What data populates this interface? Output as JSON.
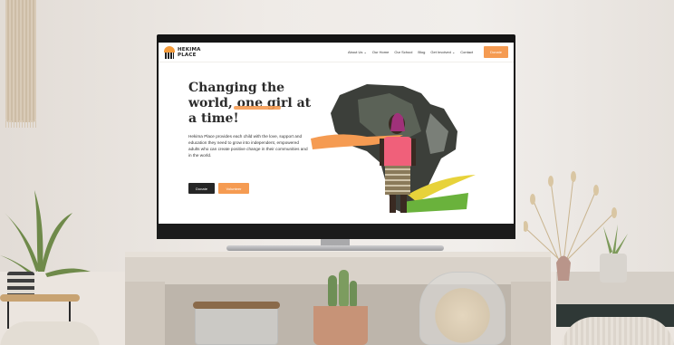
{
  "site": {
    "logo_line1": "HEKIMA",
    "logo_line2": "PLACE"
  },
  "nav": {
    "items": [
      {
        "label": "About Us ⌄"
      },
      {
        "label": "Our Home"
      },
      {
        "label": "Our School"
      },
      {
        "label": "Blog"
      },
      {
        "label": "Get Involved ⌄"
      },
      {
        "label": "Contact"
      }
    ],
    "donate_label": "Donate"
  },
  "hero": {
    "title_part1": "Changing the world, ",
    "title_highlight": "one girl",
    "title_part2": " at a time!",
    "description": "Hekima Place provides each child with the love, support and education they need to grow into independent, empowered adults who can create positive change in their communities and in the world.",
    "donate_button": "Donate",
    "volunteer_button": "Volunteer"
  },
  "colors": {
    "accent": "#f59b52",
    "dark": "#262626",
    "green_stroke": "#6ab23c",
    "yellow_stroke": "#e7d23a"
  },
  "icons": {
    "logo": "sun-over-bars-logo-icon",
    "dropdown": "chevron-down-icon"
  }
}
